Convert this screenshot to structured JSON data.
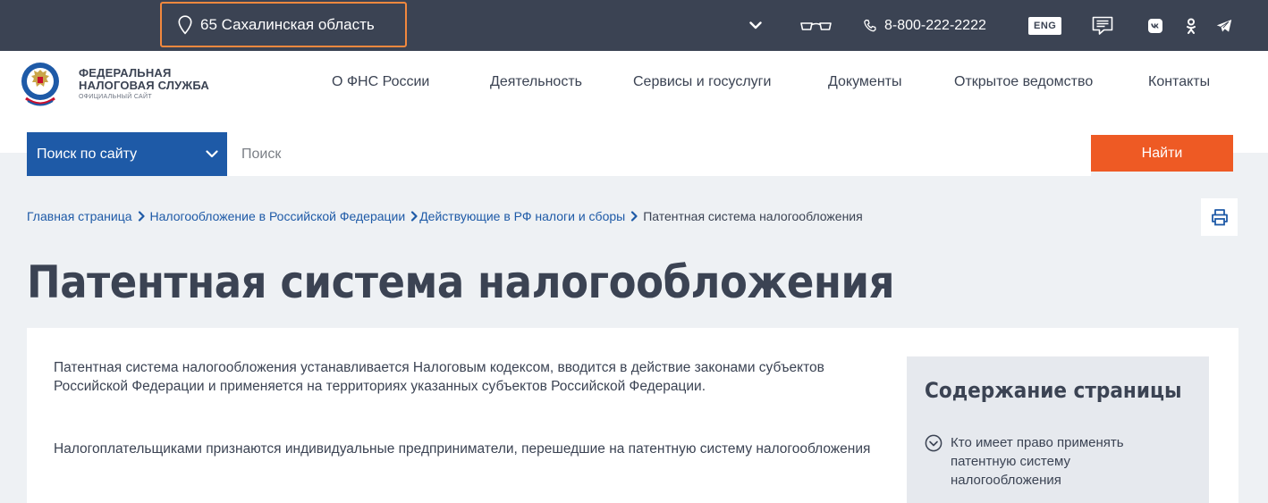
{
  "topbar": {
    "region": "65 Сахалинская область",
    "phone": "8-800-222-2222",
    "lang": "ENG"
  },
  "logo": {
    "line1": "ФЕДЕРАЛЬНАЯ",
    "line2": "НАЛОГОВАЯ СЛУЖБА",
    "line3": "ОФИЦИАЛЬНЫЙ САЙТ"
  },
  "nav": [
    "О ФНС России",
    "Деятельность",
    "Сервисы и госуслуги",
    "Документы",
    "Открытое ведомство",
    "Контакты"
  ],
  "search": {
    "scope": "Поиск по сайту",
    "placeholder": "Поиск",
    "button": "Найти"
  },
  "breadcrumb": [
    "Главная страница",
    "Налогообложение в Российской Федерации",
    "Действующие в РФ налоги и сборы",
    "Патентная система налогообложения"
  ],
  "page": {
    "title": "Патентная система налогообложения",
    "para1": "Патентная система налогообложения устанавливается Налоговым кодексом, вводится в действие законами субъектов Российской Федерации и применяется на территориях указанных субъектов Российской Федерации.",
    "para2": "Налогоплательщиками признаются индивидуальные предприниматели, перешедшие на патентную систему налогообложения"
  },
  "toc": {
    "title": "Содержание страницы",
    "items": [
      "Кто имеет право применять патентную систему налогообложения"
    ]
  },
  "colors": {
    "topbar": "#3b4353",
    "brand_blue": "#1e5aa7",
    "accent_orange": "#ee5a24",
    "highlight": "#f2883e"
  }
}
